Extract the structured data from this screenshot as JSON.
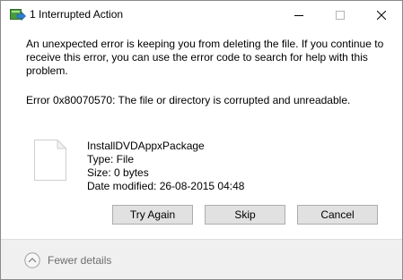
{
  "window": {
    "title": "1 Interrupted Action",
    "controls": {
      "minimize": "minimize-icon",
      "maximize": "maximize-icon",
      "close": "close-icon"
    }
  },
  "message": {
    "body": "An unexpected error is keeping you from deleting the file. If you continue to receive this error, you can use the error code to search for help with this problem.",
    "error": "Error 0x80070570: The file or directory is corrupted and unreadable."
  },
  "file": {
    "icon": "file-icon",
    "name": "InstallDVDAppxPackage",
    "type": "Type: File",
    "size": "Size: 0 bytes",
    "modified": "Date modified: 26-08-2015 04:48"
  },
  "buttons": {
    "try_again": "Try Again",
    "skip": "Skip",
    "cancel": "Cancel"
  },
  "footer": {
    "details_label": "Fewer details",
    "icon": "chevron-up-circle-icon"
  }
}
